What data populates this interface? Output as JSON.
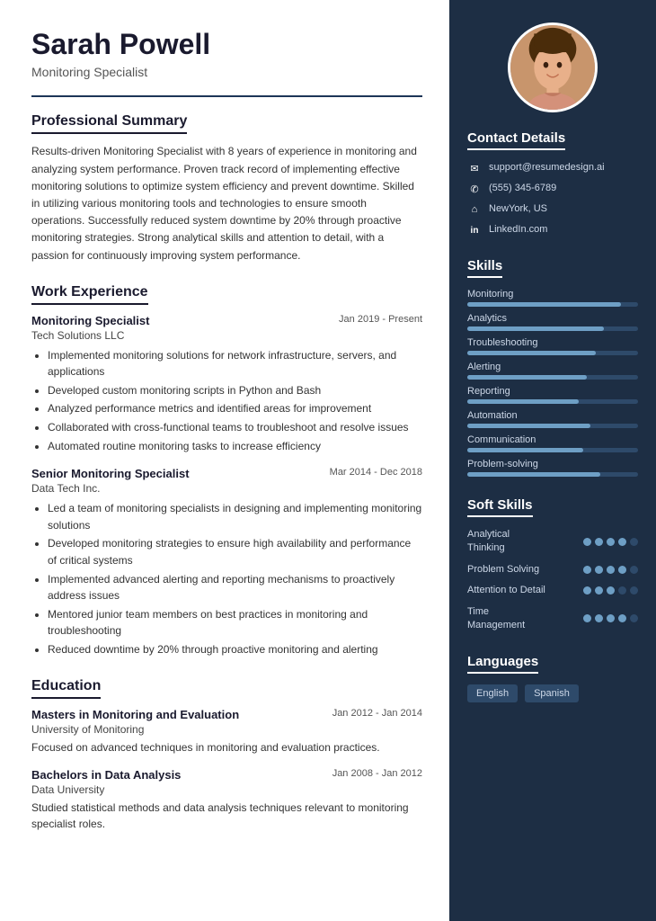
{
  "header": {
    "name": "Sarah Powell",
    "job_title": "Monitoring Specialist"
  },
  "sections": {
    "summary": {
      "title": "Professional Summary",
      "text": "Results-driven Monitoring Specialist with 8 years of experience in monitoring and analyzing system performance. Proven track record of implementing effective monitoring solutions to optimize system efficiency and prevent downtime. Skilled in utilizing various monitoring tools and technologies to ensure smooth operations. Successfully reduced system downtime by 20% through proactive monitoring strategies. Strong analytical skills and attention to detail, with a passion for continuously improving system performance."
    },
    "work_experience": {
      "title": "Work Experience",
      "jobs": [
        {
          "title": "Monitoring Specialist",
          "company": "Tech Solutions LLC",
          "dates": "Jan 2019 - Present",
          "bullets": [
            "Implemented monitoring solutions for network infrastructure, servers, and applications",
            "Developed custom monitoring scripts in Python and Bash",
            "Analyzed performance metrics and identified areas for improvement",
            "Collaborated with cross-functional teams to troubleshoot and resolve issues",
            "Automated routine monitoring tasks to increase efficiency"
          ]
        },
        {
          "title": "Senior Monitoring Specialist",
          "company": "Data Tech Inc.",
          "dates": "Mar 2014 - Dec 2018",
          "bullets": [
            "Led a team of monitoring specialists in designing and implementing monitoring solutions",
            "Developed monitoring strategies to ensure high availability and performance of critical systems",
            "Implemented advanced alerting and reporting mechanisms to proactively address issues",
            "Mentored junior team members on best practices in monitoring and troubleshooting",
            "Reduced downtime by 20% through proactive monitoring and alerting"
          ]
        }
      ]
    },
    "education": {
      "title": "Education",
      "items": [
        {
          "degree": "Masters in Monitoring and Evaluation",
          "school": "University of Monitoring",
          "dates": "Jan 2012 - Jan 2014",
          "description": "Focused on advanced techniques in monitoring and evaluation practices."
        },
        {
          "degree": "Bachelors in Data Analysis",
          "school": "Data University",
          "dates": "Jan 2008 - Jan 2012",
          "description": "Studied statistical methods and data analysis techniques relevant to monitoring specialist roles."
        }
      ]
    }
  },
  "sidebar": {
    "contact": {
      "title": "Contact Details",
      "items": [
        {
          "icon": "✉",
          "text": "support@resumedesign.ai"
        },
        {
          "icon": "✆",
          "text": "(555) 345-6789"
        },
        {
          "icon": "⌂",
          "text": "NewYork, US"
        },
        {
          "icon": "in",
          "text": "LinkedIn.com"
        }
      ]
    },
    "skills": {
      "title": "Skills",
      "items": [
        {
          "name": "Monitoring",
          "pct": 90
        },
        {
          "name": "Analytics",
          "pct": 80
        },
        {
          "name": "Troubleshooting",
          "pct": 75
        },
        {
          "name": "Alerting",
          "pct": 70
        },
        {
          "name": "Reporting",
          "pct": 65
        },
        {
          "name": "Automation",
          "pct": 72
        },
        {
          "name": "Communication",
          "pct": 68
        },
        {
          "name": "Problem-solving",
          "pct": 78
        }
      ]
    },
    "soft_skills": {
      "title": "Soft Skills",
      "items": [
        {
          "name": "Analytical Thinking",
          "filled": 4,
          "total": 5
        },
        {
          "name": "Problem Solving",
          "filled": 4,
          "total": 5
        },
        {
          "name": "Attention to Detail",
          "filled": 3,
          "total": 5
        },
        {
          "name": "Time Management",
          "filled": 4,
          "total": 5
        }
      ]
    },
    "languages": {
      "title": "Languages",
      "items": [
        "English",
        "Spanish"
      ]
    }
  }
}
